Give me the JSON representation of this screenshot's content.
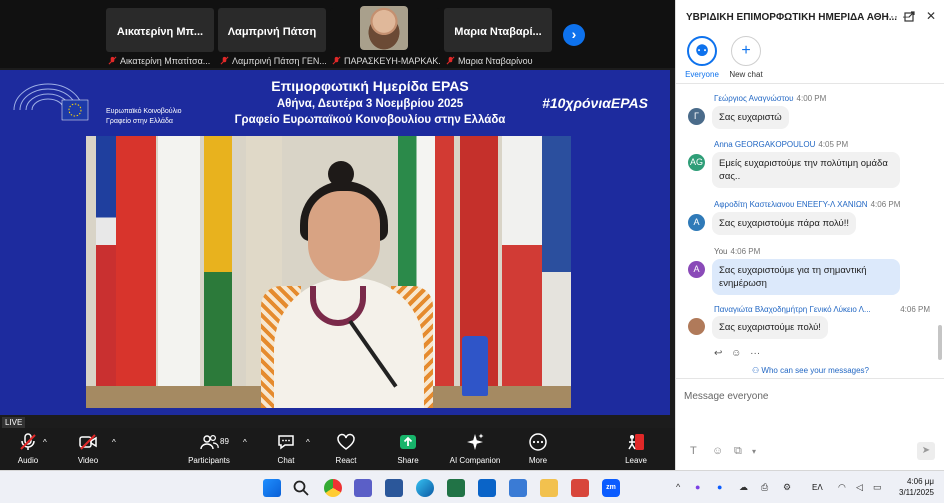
{
  "thumbnails": [
    {
      "name": "Αικατερίνη Μπ...",
      "footer": "Αικατερίνη Μπατίτσα..."
    },
    {
      "name": "Λαμπρινή Πάτση",
      "footer": "Λαμπρινή Πάτση ΓΕΝ..."
    },
    {
      "name": "",
      "footer": "ΠΑΡΑΣΚΕΥΗ-ΜΑΡΚΑΚ..."
    },
    {
      "name": "Μαρια Νταβαρί...",
      "footer": "Μαρια Νταβαρίνου"
    }
  ],
  "banner": {
    "ep_line1": "Ευρωπαϊκό Κοινοβούλιο",
    "ep_line2": "Γραφείο στην Ελλάδα",
    "title": "Επιμορφωτική Ημερίδα EPAS",
    "subtitle1": "Αθήνα, Δευτέρα 3 Νοεμβρίου 2025",
    "subtitle2": "Γραφείο Ευρωπαϊκού Κοινοβουλίου στην Ελλάδα",
    "hashtag": "#10χρόνιαEPAS"
  },
  "live_label": "LIVE",
  "toolbar": {
    "audio": "Audio",
    "video": "Video",
    "participants": "Participants",
    "participants_count": "89",
    "chat": "Chat",
    "react": "React",
    "share": "Share",
    "ai_companion": "AI Companion",
    "more": "More",
    "leave": "Leave"
  },
  "chat": {
    "title": "ΥΒΡΙΔΙΚΗ ΕΠΙΜΟΡΦΩΤΙΚΗ ΗΜΕΡΙΔΑ ΑΘΗ...",
    "tab_everyone": "Everyone",
    "tab_new_chat": "New chat",
    "messages": [
      {
        "sender": "Γεώργιος Αναγνώστου",
        "time": "4:00 PM",
        "avatar": "Γ",
        "avatar_color": "#4a6b8a",
        "text": "Σας ευχαριστώ"
      },
      {
        "sender": "Anna GEORGAKOPOULOU",
        "time": "4:05 PM",
        "avatar": "AG",
        "avatar_color": "#2f9e78",
        "text": "Εμείς ευχαριστούμε την πολύτιμη ομάδα σας.."
      },
      {
        "sender": "Αφροδίτη Καστελιανου ΕΝΕΕΓΥ-Λ ΧΑΝΙΩΝ",
        "time": "4:06 PM",
        "avatar": "A",
        "avatar_color": "#2f7ab8",
        "text": "Σας ευχαριστούμε πάρα πολύ!!"
      },
      {
        "sender": "You",
        "time": "4:06 PM",
        "avatar": "A",
        "avatar_color": "#8a4ab8",
        "text": "Σας ευχαριστούμε για τη σημαντική ενημέρωση"
      },
      {
        "sender": "Παναγιώτα Βλαχοδημήτρη Γενικό Λύκειο Λ...",
        "time": "4:06 PM",
        "avatar": "",
        "avatar_color": "#b07a5a",
        "text": "Σας ευχαριστούμε πολύ!"
      }
    ],
    "who_can_see": "Who can see your messages?",
    "input_placeholder": "Message everyone"
  },
  "taskbar": {
    "language": "ΕΛ",
    "time": "4:06 μμ",
    "date": "3/11/2025"
  },
  "colors": {
    "zoom_blue": "#0e72ed",
    "banner_blue": "#1d2b9e",
    "leave_red": "#e02828"
  }
}
